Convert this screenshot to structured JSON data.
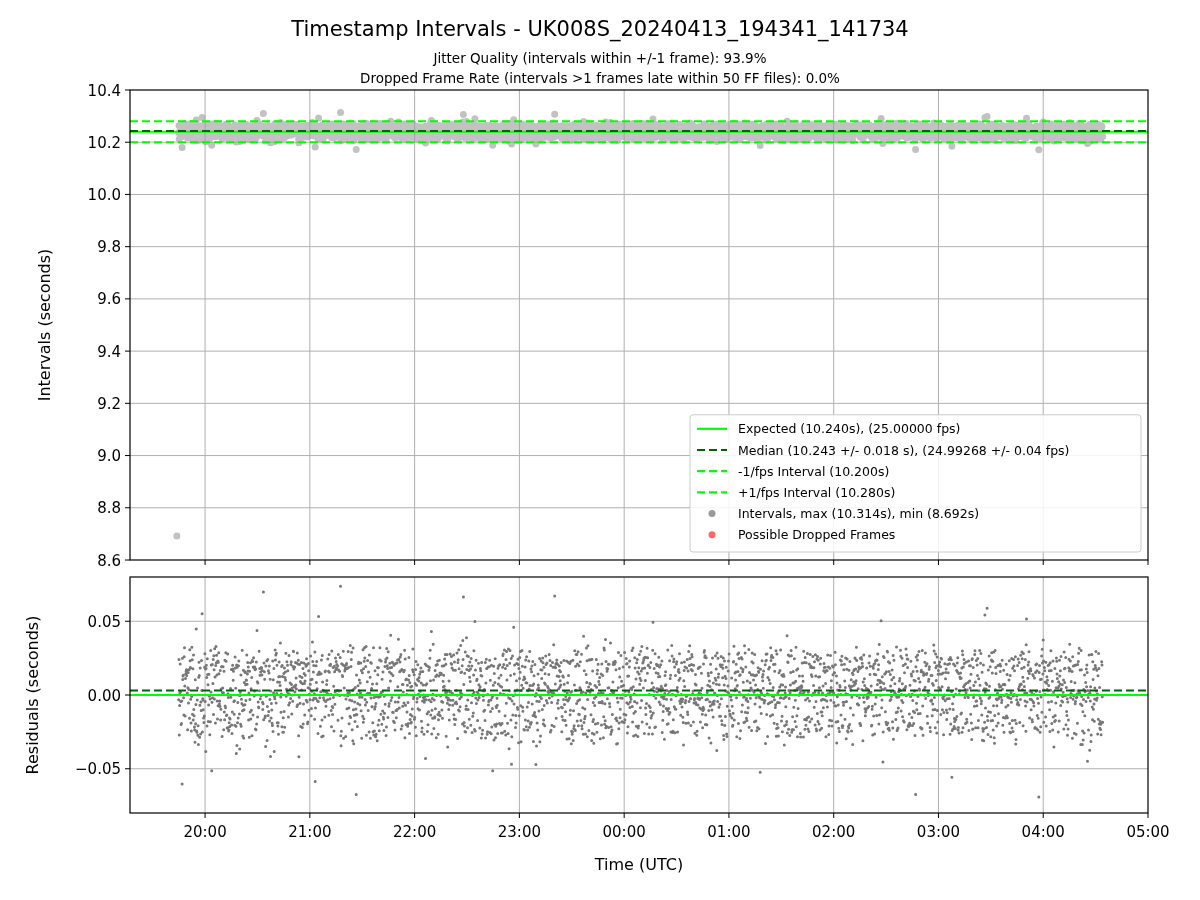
{
  "figure": {
    "title": "Timestamp Intervals - UK008S_20240413_194341_141734",
    "subtitles": [
      "Jitter Quality (intervals within +/-1 frame): 93.9%",
      "Dropped Frame Rate (intervals >1 frames late within 50 FF files): 0.0%"
    ]
  },
  "intervals_panel": {
    "chart_data": {
      "type": "line",
      "ylabel": "Intervals (seconds)",
      "x": [
        "2024-04-13T19:17",
        "2024-04-14T05:00"
      ],
      "xlim": [
        "2024-04-13T19:17",
        "2024-04-14T05:00"
      ],
      "ylim": [
        8.6,
        10.4
      ],
      "grid": true,
      "legend": true,
      "yticks": [
        {
          "value": 8.6,
          "label": "8.6"
        },
        {
          "value": 8.8,
          "label": "8.8"
        },
        {
          "value": 9.0,
          "label": "9.0"
        },
        {
          "value": 9.2,
          "label": "9.2"
        },
        {
          "value": 9.4,
          "label": "9.4"
        },
        {
          "value": 9.6,
          "label": "9.6"
        },
        {
          "value": 9.8,
          "label": "9.8"
        },
        {
          "value": 10.0,
          "label": "10.0"
        },
        {
          "value": 10.2,
          "label": "10.2"
        },
        {
          "value": 10.4,
          "label": "10.4"
        }
      ],
      "series": [
        {
          "name": "Expected (10.240s), (25.00000 fps)",
          "color": "#00ff00",
          "line_style": "solid",
          "values": [
            10.24,
            10.24
          ]
        },
        {
          "name": "Median (10.243 +/- 0.018 s), (24.99268 +/- 0.04 fps)",
          "color": "#006400",
          "line_style": "dashed",
          "values": [
            10.243,
            10.243
          ]
        },
        {
          "name": "-1/fps Interval (10.200s)",
          "color": "#00ff00",
          "line_style": "dashed",
          "values": [
            10.2,
            10.2
          ]
        },
        {
          "name": "+1/fps Interval (10.280s)",
          "color": "#00ff00",
          "line_style": "dashed",
          "values": [
            10.28,
            10.28
          ]
        }
      ]
    },
    "marker_legend": [
      {
        "label": "Intervals, max (10.314s), min (8.692s)",
        "color": "#999999"
      },
      {
        "label": "Possible Dropped Frames",
        "color": "#ff6666"
      }
    ]
  },
  "residuals_panel": {
    "chart_data": {
      "type": "line",
      "ylabel": "Residuals (seconds)",
      "xlabel": "Time (UTC)",
      "x": [
        "2024-04-13T19:17",
        "2024-04-14T05:00"
      ],
      "xlim": [
        "2024-04-13T19:17",
        "2024-04-14T05:00"
      ],
      "ylim": [
        -0.08,
        0.08
      ],
      "grid": true,
      "xticks": [
        {
          "value": "2024-04-13T20:00",
          "label": "20:00"
        },
        {
          "value": "2024-04-13T21:00",
          "label": "21:00"
        },
        {
          "value": "2024-04-13T22:00",
          "label": "22:00"
        },
        {
          "value": "2024-04-13T23:00",
          "label": "23:00"
        },
        {
          "value": "2024-04-14T00:00",
          "label": "00:00"
        },
        {
          "value": "2024-04-14T01:00",
          "label": "01:00"
        },
        {
          "value": "2024-04-14T02:00",
          "label": "02:00"
        },
        {
          "value": "2024-04-14T03:00",
          "label": "03:00"
        },
        {
          "value": "2024-04-14T04:00",
          "label": "04:00"
        },
        {
          "value": "2024-04-14T05:00",
          "label": "05:00"
        }
      ],
      "yticks": [
        {
          "value": -0.05,
          "label": "−0.05"
        },
        {
          "value": 0,
          "label": "0.00"
        },
        {
          "value": 0.05,
          "label": "0.05"
        }
      ],
      "series": [
        {
          "color": "#00ff00",
          "line_style": "solid",
          "values": [
            0,
            0
          ]
        },
        {
          "color": "#006400",
          "line_style": "dashed",
          "values": [
            0.003,
            0.003
          ]
        }
      ]
    }
  }
}
